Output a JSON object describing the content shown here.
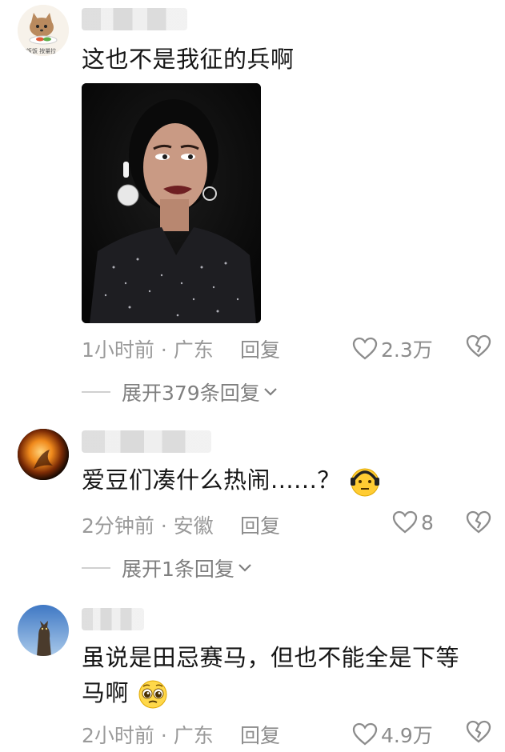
{
  "comments": [
    {
      "text": "这也不是我征的兵啊",
      "time": "1小时前",
      "location": "广东",
      "reply_label": "回复",
      "likes": "2.3万",
      "expand_label": "展开379条回复",
      "avatar_caption": "吃饭饭 按量拉"
    },
    {
      "text": "爱豆们凑什么热闹......？",
      "time": "2分钟前",
      "location": "安徽",
      "reply_label": "回复",
      "likes": "8",
      "expand_label": "展开1条回复"
    },
    {
      "text_line1": "虽说是田忌赛马，但也不能全是下等",
      "text_line2": "马啊",
      "time": "2小时前",
      "location": "广东",
      "reply_label": "回复",
      "likes": "4.9万"
    }
  ],
  "meta_separator": "·",
  "icons": [
    "heart-outline-icon",
    "broken-heart-icon",
    "chevron-down-icon",
    "worried-face-emoji",
    "pleading-face-emoji"
  ],
  "colors": {
    "meta": "#9a9a9a",
    "text": "#161616",
    "divider": "#d0d0d0"
  }
}
